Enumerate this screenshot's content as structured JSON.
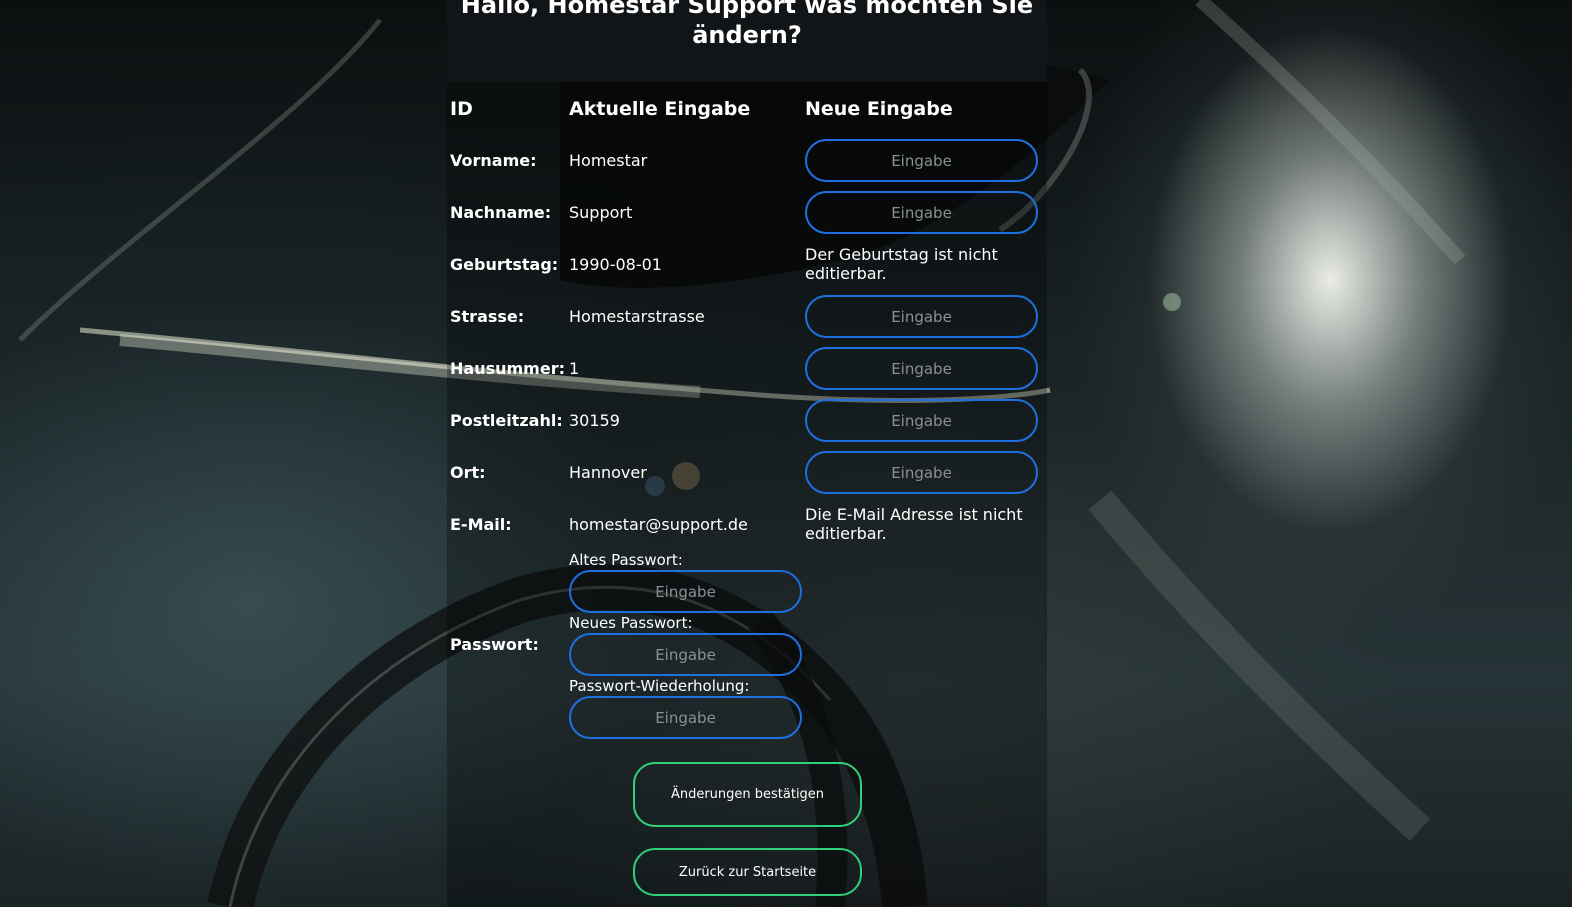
{
  "page": {
    "title": "Hallo, Homestar Support was möchten Sie ändern?"
  },
  "columns": {
    "id": "ID",
    "current": "Aktuelle Eingabe",
    "new": "Neue Eingabe"
  },
  "rows": [
    {
      "label": "Vorname:",
      "value": "Homestar",
      "placeholder": "Eingabe"
    },
    {
      "label": "Nachname:",
      "value": "Support",
      "placeholder": "Eingabe"
    },
    {
      "label": "Geburtstag:",
      "value": "1990-08-01",
      "note": "Der Geburtstag ist nicht editierbar."
    },
    {
      "label": "Strasse:",
      "value": "Homestarstrasse",
      "placeholder": "Eingabe"
    },
    {
      "label": "Hausummer:",
      "value": "1",
      "placeholder": "Eingabe"
    },
    {
      "label": "Postleitzahl:",
      "value": "30159",
      "placeholder": "Eingabe"
    },
    {
      "label": "Ort:",
      "value": "Hannover",
      "placeholder": "Eingabe"
    },
    {
      "label": "E-Mail:",
      "value": "homestar@support.de",
      "note": "Die E-Mail Adresse ist nicht editierbar."
    }
  ],
  "password": {
    "label": "Passwort:",
    "old_label": "Altes Passwort:",
    "new_label": "Neues Passwort:",
    "repeat_label": "Passwort-Wiederholung:",
    "placeholder": "Eingabe"
  },
  "buttons": {
    "confirm": "Änderungen bestätigen",
    "back": "Zurück zur Startseite"
  },
  "colors": {
    "field_border": "#1f6fe0",
    "button_border": "#2fd07a"
  }
}
